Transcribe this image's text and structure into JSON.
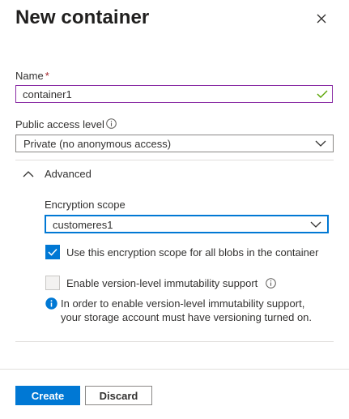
{
  "panel": {
    "title": "New container"
  },
  "form": {
    "name_label": "Name",
    "name_required_marker": "*",
    "name_value": "container1",
    "public_access_label": "Public access level",
    "public_access_value": "Private (no anonymous access)",
    "advanced_label": "Advanced",
    "encryption_scope_label": "Encryption scope",
    "encryption_scope_value": "customeres1",
    "use_scope_label": "Use this encryption scope for all blobs in the container",
    "use_scope_checked": true,
    "immutability_label": "Enable version-level immutability support",
    "immutability_checked": false,
    "immutability_info": "In order to enable version-level immutability support, your storage account must have versioning turned on."
  },
  "footer": {
    "create_label": "Create",
    "discard_label": "Discard"
  },
  "icons": {
    "close": "close-icon",
    "valid": "checkmark-icon",
    "info": "info-icon",
    "chevron_down": "chevron-down-icon",
    "chevron_up": "chevron-up-icon"
  },
  "colors": {
    "accent": "#0078d4",
    "focused_border": "#8a2da5",
    "valid_check": "#57a300",
    "required": "#a4262c"
  }
}
